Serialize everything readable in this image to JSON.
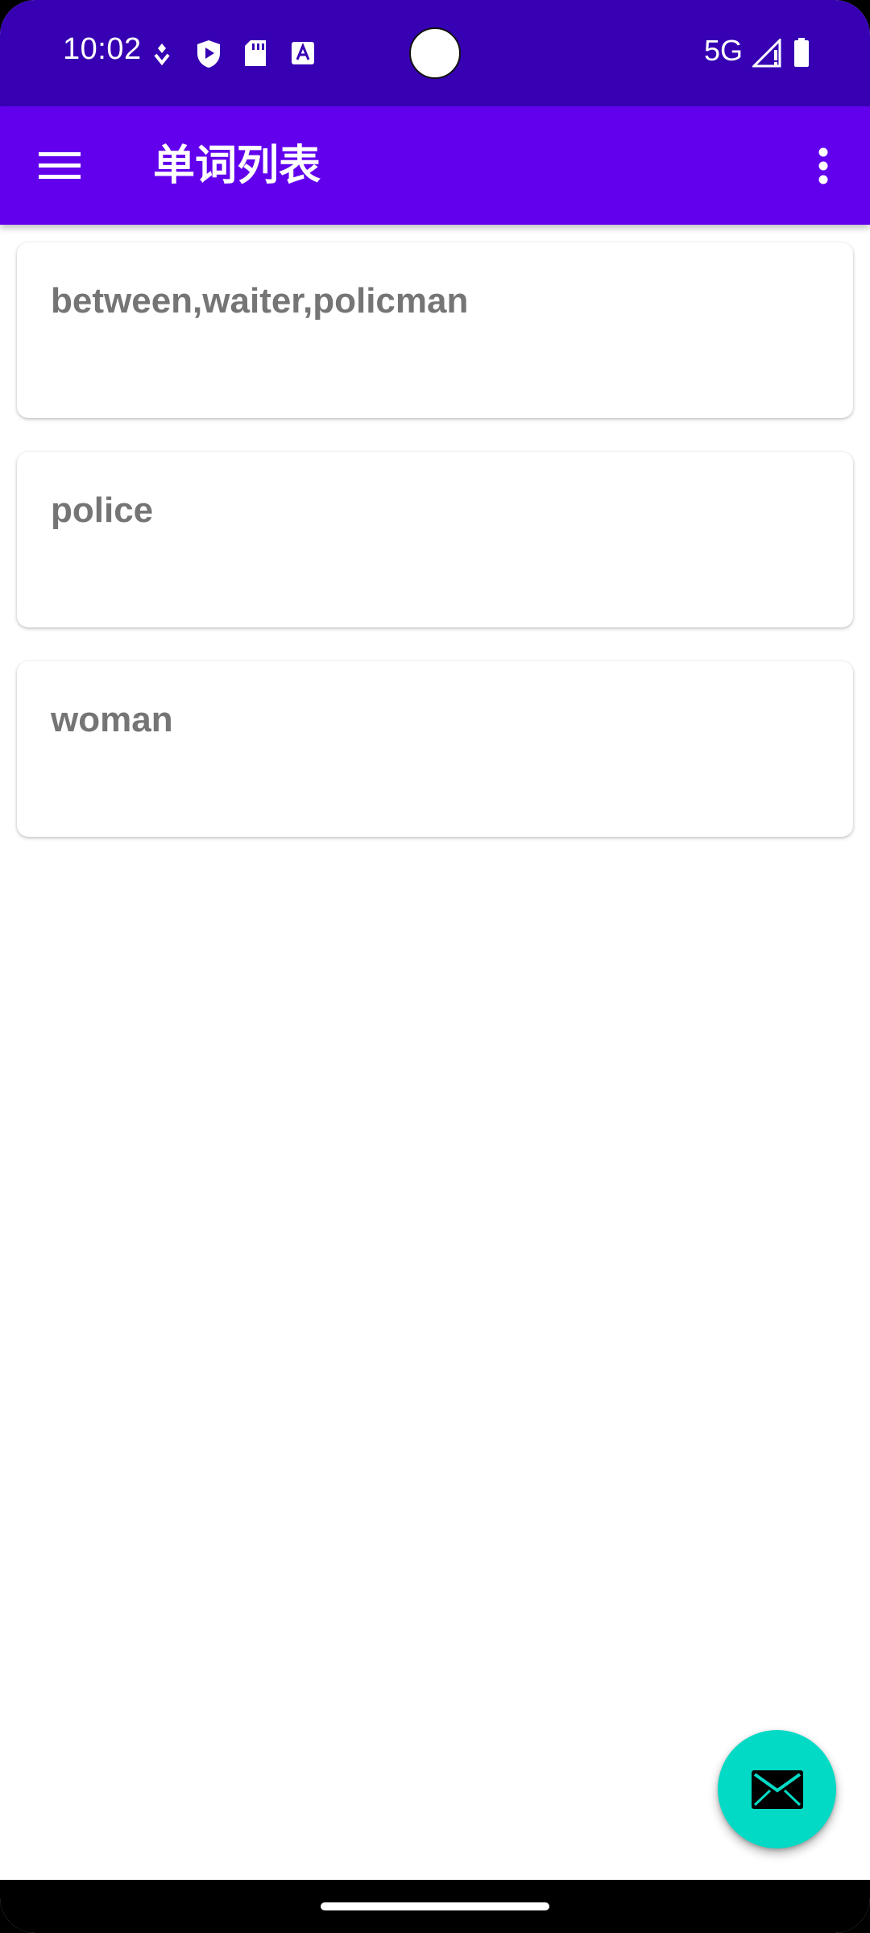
{
  "status_bar": {
    "time": "10:02",
    "network": "5G",
    "background_color": "#3700B3",
    "icons": [
      "assistant-icon",
      "shield-play-icon",
      "sd-card-icon",
      "text-a-icon",
      "signal-icon",
      "battery-icon"
    ]
  },
  "app_bar": {
    "title": "单词列表",
    "background_color": "#6200EE",
    "menu_icon": "hamburger-menu-icon",
    "overflow_icon": "more-vert-icon"
  },
  "words": [
    {
      "text": "between,waiter,policman"
    },
    {
      "text": "police"
    },
    {
      "text": "woman"
    }
  ],
  "fab": {
    "icon": "mail-icon",
    "background_color": "#03DAC5"
  }
}
